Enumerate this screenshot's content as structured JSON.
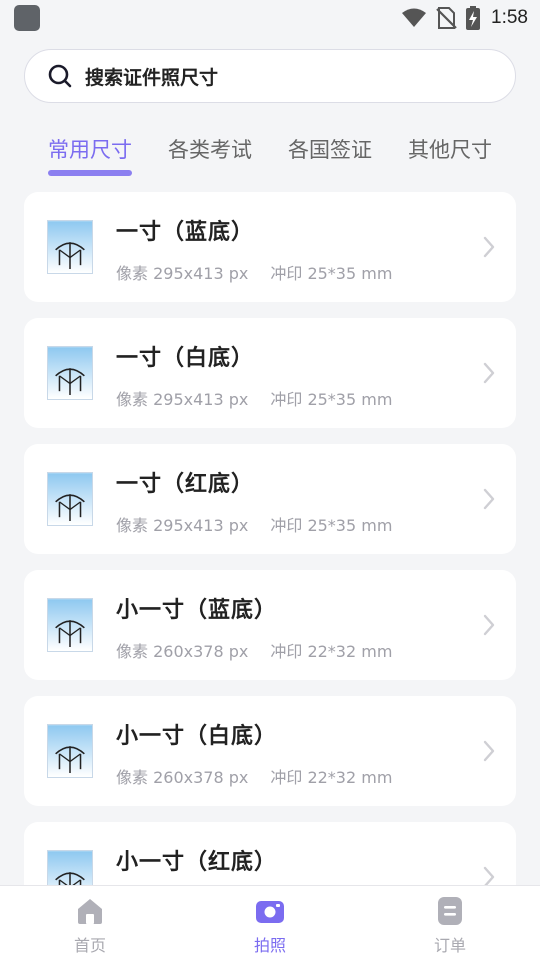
{
  "status_bar": {
    "time": "1:58",
    "icons": [
      "app-icon",
      "wifi-icon",
      "no-sim-icon",
      "battery-charging-icon"
    ]
  },
  "search": {
    "placeholder": "搜索证件照尺寸",
    "icon": "search-icon"
  },
  "tabs": [
    {
      "label": "常用尺寸",
      "active": true
    },
    {
      "label": "各类考试",
      "active": false
    },
    {
      "label": "各国签证",
      "active": false
    },
    {
      "label": "其他尺寸",
      "active": false
    }
  ],
  "sizes": [
    {
      "title": "一寸（蓝底）",
      "pixels": "像素 295x413 px",
      "print": "冲印 25*35 mm"
    },
    {
      "title": "一寸（白底）",
      "pixels": "像素 295x413 px",
      "print": "冲印 25*35 mm"
    },
    {
      "title": "一寸（红底）",
      "pixels": "像素 295x413 px",
      "print": "冲印 25*35 mm"
    },
    {
      "title": "小一寸（蓝底）",
      "pixels": "像素 260x378 px",
      "print": "冲印 22*32 mm"
    },
    {
      "title": "小一寸（白底）",
      "pixels": "像素 260x378 px",
      "print": "冲印 22*32 mm"
    },
    {
      "title": "小一寸（红底）",
      "pixels": "",
      "print": ""
    }
  ],
  "bottom_nav": [
    {
      "label": "首页",
      "icon": "home-icon",
      "active": false
    },
    {
      "label": "拍照",
      "icon": "camera-icon",
      "active": true
    },
    {
      "label": "订单",
      "icon": "order-icon",
      "active": false
    }
  ],
  "colors": {
    "accent": "#7b6cf0",
    "background": "#f4f5f7",
    "card": "#ffffff",
    "inactive": "#a9a9b0"
  }
}
